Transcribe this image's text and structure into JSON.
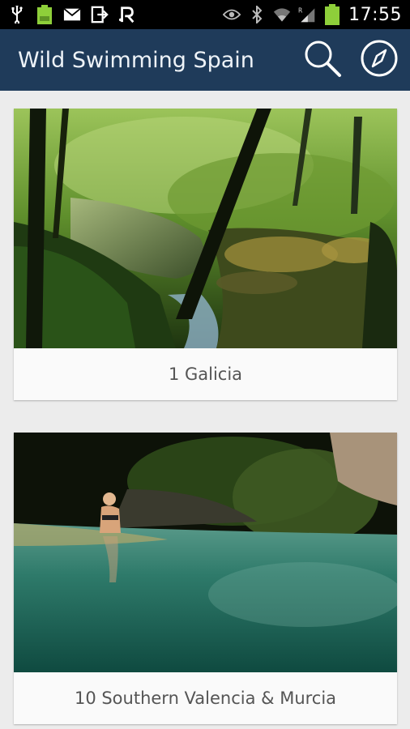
{
  "status_bar": {
    "time": "17:55",
    "left_icons": [
      "usb-icon",
      "battery-full-icon",
      "mail-icon",
      "sync-icon",
      "r-app-icon"
    ],
    "right_icons": [
      "eye-icon",
      "bluetooth-icon",
      "wifi-icon",
      "signal-icon",
      "battery-icon"
    ],
    "battery_level": 1.0
  },
  "app_bar": {
    "title": "Wild Swimming Spain",
    "color": "#1f3b5a",
    "actions": [
      {
        "name": "search",
        "icon": "search-icon"
      },
      {
        "name": "compass",
        "icon": "compass-icon"
      }
    ]
  },
  "cards": [
    {
      "label": "1 Galicia",
      "image": "forest-river-photo"
    },
    {
      "label": "10 Southern Valencia & Murcia",
      "image": "turquoise-pool-swimmer-photo"
    }
  ]
}
